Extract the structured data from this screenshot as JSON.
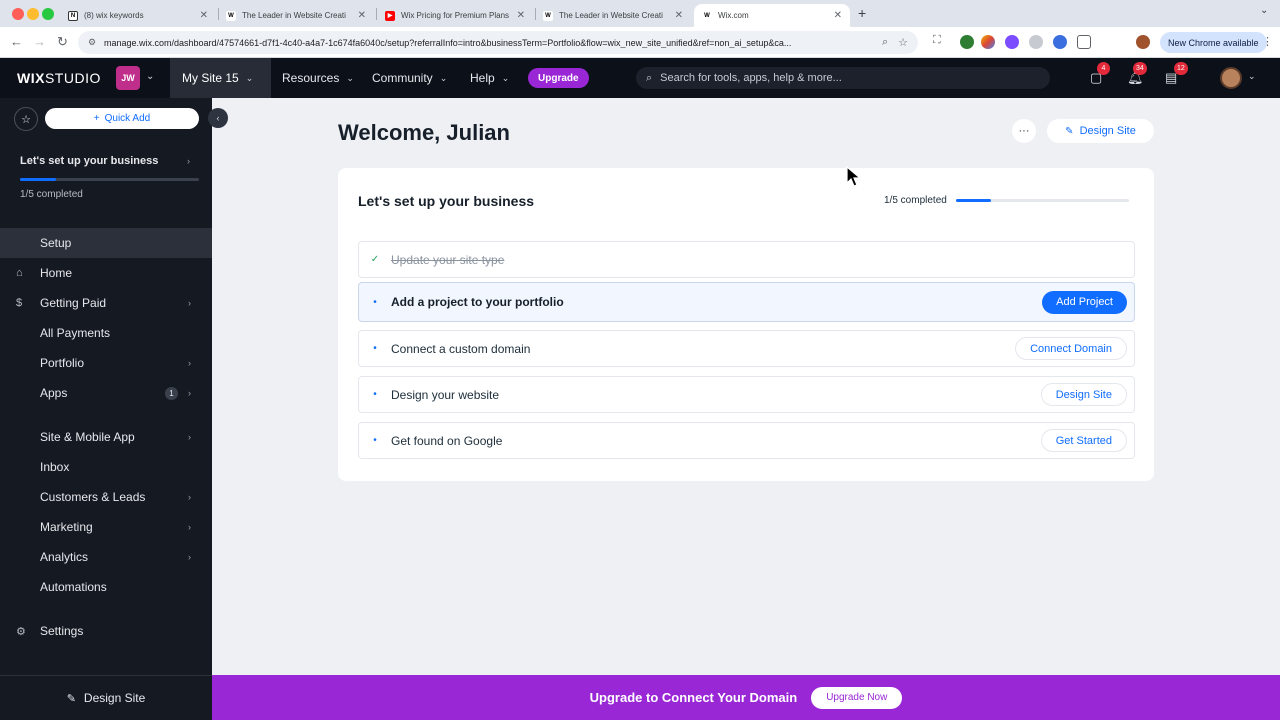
{
  "browser": {
    "tabs": [
      {
        "title": "(8) wix keywords",
        "favicon": "notion-icon"
      },
      {
        "title": "The Leader in Website Creati",
        "favicon": "wix-icon"
      },
      {
        "title": "Wix Pricing for Premium Plans",
        "favicon": "youtube-icon"
      },
      {
        "title": "The Leader in Website Creati",
        "favicon": "wix-icon"
      },
      {
        "title": "Wix.com",
        "favicon": "wix-icon"
      }
    ],
    "active_tab": 4,
    "url": "manage.wix.com/dashboard/47574661-d7f1-4c40-a4a7-1c674fa6040c/setup?referralInfo=intro&businessTerm=Portfolio&flow=wix_new_site_unified&ref=non_ai_setup&ca...",
    "new_chrome_label": "New Chrome available",
    "colors": {
      "close": "#ff5f57",
      "minimize": "#febc2e",
      "maximize": "#28c840"
    }
  },
  "topbar": {
    "logo_bold": "WIX",
    "logo_light": "STUDIO",
    "site_badge": "JW",
    "site_name": "My Site 15",
    "nav": [
      "Resources",
      "Community",
      "Help"
    ],
    "upgrade_label": "Upgrade",
    "search_placeholder": "Search for tools, apps, help & more...",
    "badges": {
      "messages": "4",
      "notifications": "34",
      "inbox": "12"
    }
  },
  "sidebar": {
    "quick_add": "Quick Add",
    "setup_title": "Let's set up your business",
    "setup_progress": 0.2,
    "setup_count": "1/5 completed",
    "items": [
      {
        "label": "Setup",
        "icon": "setup-icon",
        "active": true
      },
      {
        "label": "Home",
        "icon": "home-icon"
      },
      {
        "label": "Getting Paid",
        "icon": "dollar-icon",
        "arrow": true
      },
      {
        "label": "All Payments",
        "icon": "payments-icon"
      },
      {
        "label": "Portfolio",
        "icon": "portfolio-icon",
        "arrow": true
      },
      {
        "label": "Apps",
        "icon": "apps-icon",
        "arrow": true,
        "badge": "1"
      },
      {
        "label": "Site & Mobile App",
        "icon": "site-icon",
        "arrow": true
      },
      {
        "label": "Inbox",
        "icon": "inbox-icon"
      },
      {
        "label": "Customers & Leads",
        "icon": "customers-icon",
        "arrow": true
      },
      {
        "label": "Marketing",
        "icon": "marketing-icon",
        "arrow": true
      },
      {
        "label": "Analytics",
        "icon": "analytics-icon",
        "arrow": true
      },
      {
        "label": "Automations",
        "icon": "automations-icon"
      },
      {
        "label": "Settings",
        "icon": "settings-icon"
      }
    ],
    "design_site": "Design Site"
  },
  "main": {
    "welcome": "Welcome, Julian",
    "more_label": "···",
    "design_site": "Design Site",
    "card": {
      "title": "Let's set up your business",
      "count": "1/5 completed",
      "progress": 0.2,
      "tasks": [
        {
          "label": "Update your site type",
          "done": true,
          "button": ""
        },
        {
          "label": "Add a project to your portfolio",
          "done": false,
          "button": "Add Project",
          "primary": true
        },
        {
          "label": "Connect a custom domain",
          "done": false,
          "button": "Connect Domain"
        },
        {
          "label": "Design your website",
          "done": false,
          "button": "Design Site"
        },
        {
          "label": "Get found on Google",
          "done": false,
          "button": "Get Started"
        }
      ]
    }
  },
  "banner": {
    "text": "Upgrade to Connect Your Domain",
    "button": "Upgrade Now",
    "color": "#9a27d5"
  }
}
